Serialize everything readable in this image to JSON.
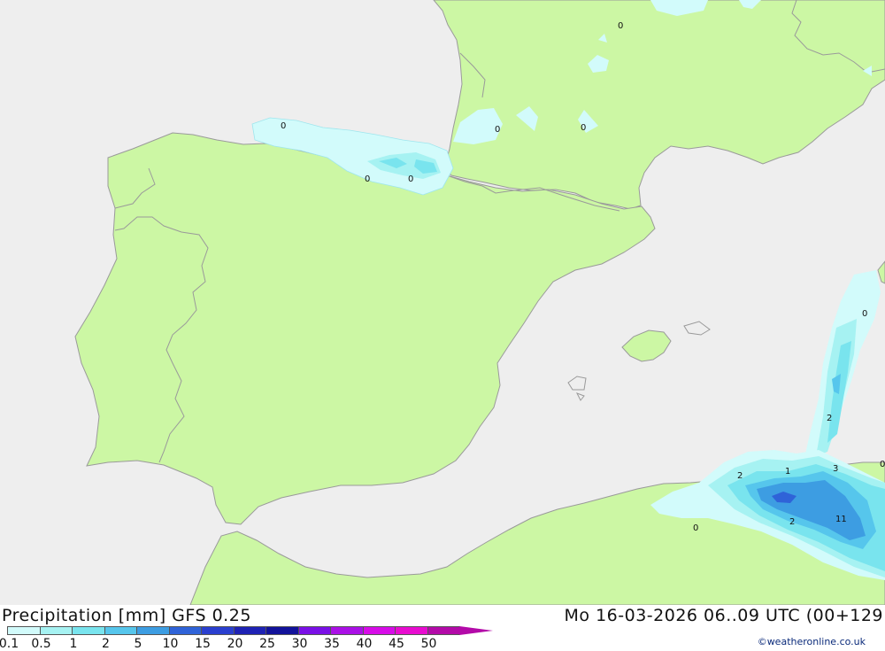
{
  "map": {
    "contour_labels": [
      {
        "text": "0",
        "kind": "north-france-1"
      },
      {
        "text": "0",
        "kind": "bay-of-biscay"
      },
      {
        "text": "0",
        "kind": "south-france-1"
      },
      {
        "text": "0",
        "kind": "south-france-2"
      },
      {
        "text": "0",
        "kind": "basque-1"
      },
      {
        "text": "0",
        "kind": "basque-2"
      },
      {
        "text": "0",
        "kind": "sardinia-sea"
      },
      {
        "text": "2",
        "kind": "sea-east"
      },
      {
        "text": "1",
        "kind": "algeria-1"
      },
      {
        "text": "3",
        "kind": "algeria-2"
      },
      {
        "text": "0",
        "kind": "east-edge"
      },
      {
        "text": "2",
        "kind": "algeria-west"
      },
      {
        "text": "0",
        "kind": "morocco-coast"
      },
      {
        "text": "2",
        "kind": "algeria-south"
      },
      {
        "text": "11",
        "kind": "algeria-max"
      }
    ],
    "colors": {
      "sea": "#eeeeee",
      "land": "#ccf7a4",
      "border": "#9a9a9a",
      "precip_0_1": "#d2fbfb",
      "precip_0_5": "#a6f2f2",
      "precip_1": "#79e4ee",
      "precip_2": "#56c6ec",
      "precip_5": "#3d9de2",
      "precip_10": "#2f63d8"
    }
  },
  "footer": {
    "title": "Precipitation [mm]  GFS 0.25",
    "datetime": "Mo 16-03-2026 06..09 UTC (00+129",
    "credit": "©weatheronline.co.uk"
  },
  "legend": {
    "ticks": [
      "0.1",
      "0.5",
      "1",
      "2",
      "5",
      "10",
      "15",
      "20",
      "25",
      "30",
      "35",
      "40",
      "45",
      "50"
    ],
    "colors": [
      "#d2fbfb",
      "#a6f2f2",
      "#79e4ee",
      "#56c6ec",
      "#3d9de2",
      "#2f63d8",
      "#2a3fcf",
      "#1e22b4",
      "#12129a",
      "#7a10e6",
      "#aa10e6",
      "#d70ce8",
      "#e80cd0",
      "#b30aa8"
    ]
  }
}
